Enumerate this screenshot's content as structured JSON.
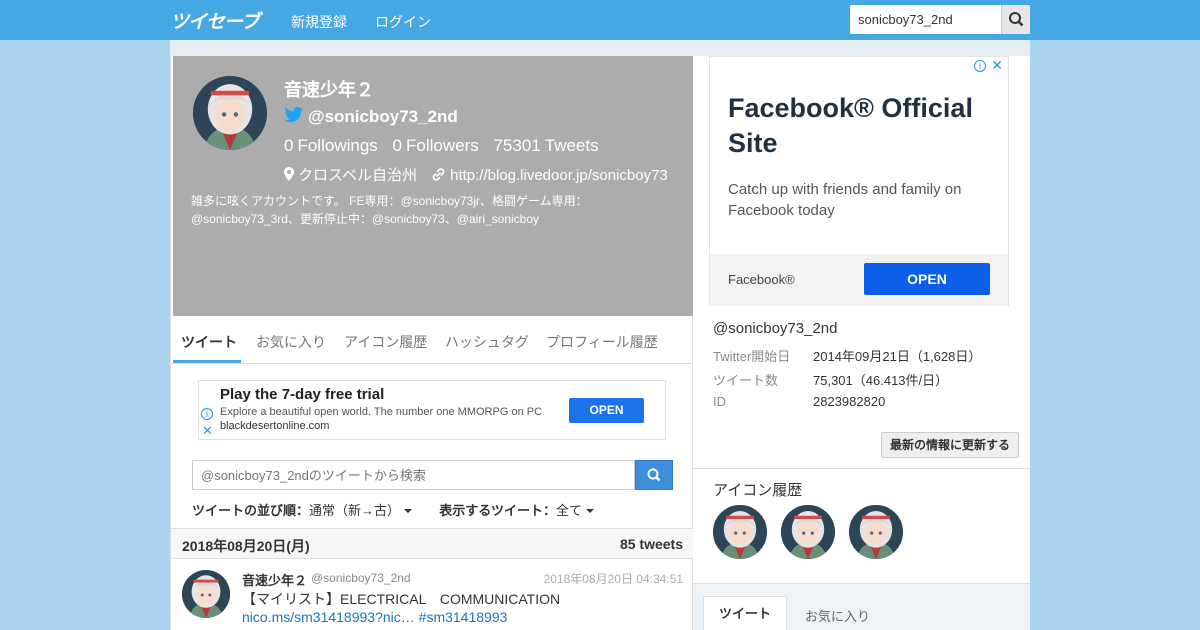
{
  "header": {
    "logo": "ツイセーブ",
    "nav": [
      "新規登録",
      "ログイン"
    ],
    "search_value": "sonicboy73_2nd"
  },
  "profile": {
    "name": "音速少年２",
    "handle": "@sonicboy73_2nd",
    "followings_count": "0",
    "followings_label": "Followings",
    "followers_count": "0",
    "followers_label": "Followers",
    "tweets_count": "75301",
    "tweets_label": "Tweets",
    "location": "クロスベル自治州",
    "url": "http://blog.livedoor.jp/sonicboy73",
    "bio": "雑多に呟くアカウントです。 FE専用：@sonicboy73jr、格闘ゲーム専用：@sonicboy73_3rd、更新停止中：@sonicboy73、@airi_sonicboy"
  },
  "tabs": [
    "ツイート",
    "お気に入り",
    "アイコン履歴",
    "ハッシュタグ",
    "プロフィール履歴"
  ],
  "ad_main": {
    "title": "Play the 7-day free trial",
    "description": "Explore a beautiful open world. The number one MMORPG on PC",
    "domain": "blackdesertonline.com",
    "button": "OPEN"
  },
  "tweet_search": {
    "placeholder": "@sonicboy73_2ndのツイートから検索"
  },
  "sort": {
    "order_label": "ツイートの並び順：",
    "order_value": "通常（新→古）",
    "filter_label": "表示するツイート：",
    "filter_value": "全て"
  },
  "day_group": {
    "date": "2018年08月20日(月)",
    "count": "85 tweets"
  },
  "tweet": {
    "name": "音速少年２",
    "handle": "@sonicboy73_2nd",
    "time": "2018年08月20日 04:34:51",
    "text_prefix": "【マイリスト】ELECTRICAL　COMMUNICATION ",
    "link": "nico.ms/sm31418993?nic…",
    "hashtag": "#sm31418993"
  },
  "ad_side": {
    "headline": "Facebook® Official Site",
    "description": "Catch up with friends and family on Facebook today",
    "brand": "Facebook®",
    "button": "OPEN"
  },
  "side_info": {
    "handle": "@sonicboy73_2nd",
    "rows": [
      {
        "key": "Twitter開始日",
        "value": "2014年09月21日（1,628日）"
      },
      {
        "key": "ツイート数",
        "value": "75,301（46.413件/日）"
      },
      {
        "key": "ID",
        "value": "2823982820"
      }
    ],
    "refresh_button": "最新の情報に更新する"
  },
  "icon_history": {
    "title": "アイコン履歴"
  },
  "side_tabs": [
    "ツイート",
    "お気に入り"
  ],
  "colors": {
    "topbar": "#46a7e5",
    "page_bg": "#a9d3ef",
    "profile_bg": "#acacac",
    "accent": "#1a73e8"
  }
}
